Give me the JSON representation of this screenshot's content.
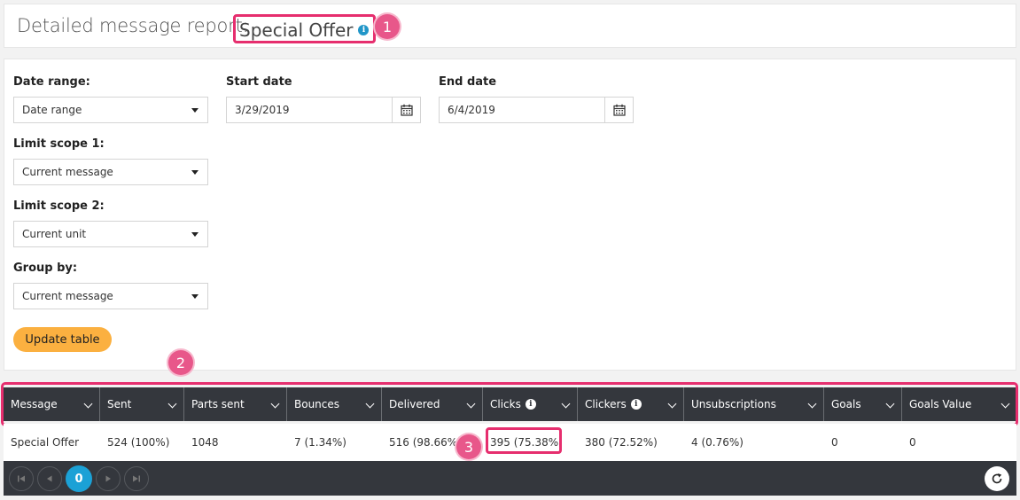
{
  "header": {
    "title_prefix": "Detailed message report:",
    "message_name": "Special Offer"
  },
  "annotations": [
    "1",
    "2",
    "3"
  ],
  "filters": {
    "date_range": {
      "label": "Date range:",
      "value": "Date range"
    },
    "start_date": {
      "label": "Start date",
      "value": "3/29/2019"
    },
    "end_date": {
      "label": "End date",
      "value": "6/4/2019"
    },
    "limit_scope_1": {
      "label": "Limit scope 1:",
      "value": "Current message"
    },
    "limit_scope_2": {
      "label": "Limit scope 2:",
      "value": "Current unit"
    },
    "group_by": {
      "label": "Group by:",
      "value": "Current message"
    },
    "update_button": "Update table"
  },
  "table": {
    "columns": [
      "Message",
      "Sent",
      "Parts sent",
      "Bounces",
      "Delivered",
      "Clicks",
      "Clickers",
      "Unsubscriptions",
      "Goals",
      "Goals Value"
    ],
    "rows": [
      [
        "Special Offer",
        "524 (100%)",
        "1048",
        "7 (1.34%)",
        "516 (98.66%)",
        "395 (75.38%)",
        "380 (72.52%)",
        "4 (0.76%)",
        "0",
        "0"
      ]
    ]
  },
  "pager": {
    "current_page": "0"
  },
  "icons": [
    "info-icon",
    "calendar-icon",
    "chevron-down-icon",
    "first-page-icon",
    "prev-page-icon",
    "next-page-icon",
    "last-page-icon",
    "refresh-icon"
  ],
  "colors": {
    "highlight": "#e62e6e",
    "badge": "#e8578a",
    "header_bg": "#34373d",
    "accent_blue": "#1ba1d6",
    "button_orange": "#fbb040"
  }
}
